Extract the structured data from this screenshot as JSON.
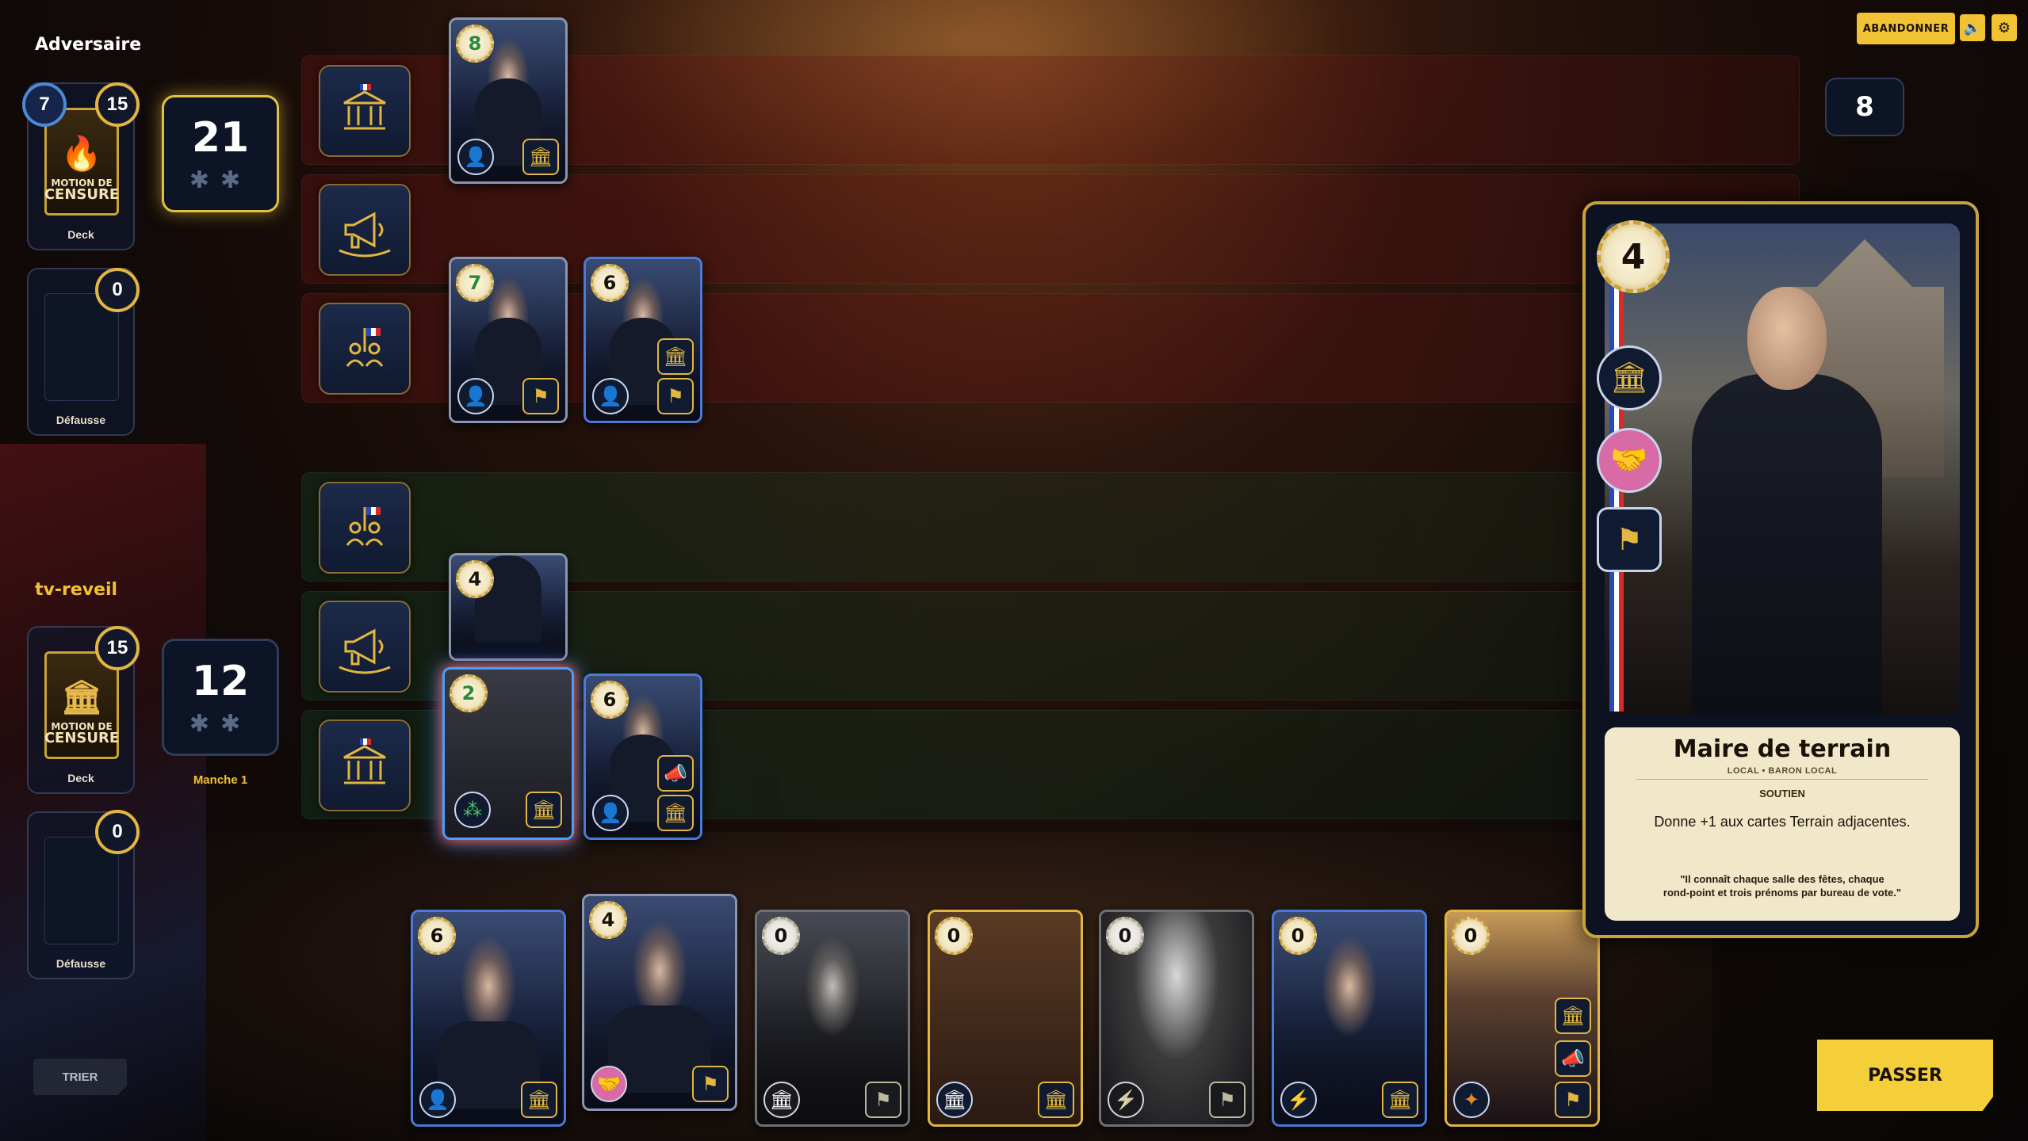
{
  "opponent": {
    "name": "Adversaire",
    "deck_label": "Deck",
    "deck_badge_left": "7",
    "deck_badge_right": "15",
    "discard_label": "Défausse",
    "discard_count": "0",
    "score": "21",
    "card_back_line1": "MOTION DE",
    "card_back_line2": "CENSURE"
  },
  "player": {
    "name": "tv-reveil",
    "deck_label": "Deck",
    "deck_badge": "15",
    "discard_label": "Défausse",
    "discard_count": "0",
    "score": "12",
    "round_label": "Manche 1",
    "card_back_line1": "MOTION DE",
    "card_back_line2": "CENSURE"
  },
  "controls": {
    "abandon_label": "ABANDONNER",
    "pass_label": "PASSER",
    "sort_label": "TRIER",
    "opponent_hand_count": "8"
  },
  "board": {
    "opponent_cards": [
      {
        "power": "8"
      },
      {
        "power": "7"
      },
      {
        "power": "6"
      }
    ],
    "player_cards": [
      {
        "power": "4"
      },
      {
        "power": "2"
      },
      {
        "power": "6"
      }
    ]
  },
  "hand": [
    {
      "power": "6"
    },
    {
      "power": "4"
    },
    {
      "power": "0"
    },
    {
      "power": "0"
    },
    {
      "power": "0"
    },
    {
      "power": "0"
    },
    {
      "power": "0"
    }
  ],
  "detail": {
    "power": "4",
    "name": "Maire de terrain",
    "tags": "LOCAL  •  BARON LOCAL",
    "type": "SOUTIEN",
    "effect": "Donne +1 aux cartes Terrain adjacentes.",
    "quote_line1": "\"Il connaît chaque salle des fêtes, chaque",
    "quote_line2": "rond-point et trois prénoms par bureau de vote.\""
  },
  "colors": {
    "accent": "#f2c235",
    "opponent_lane": "#6e1414",
    "player_lane": "#144628",
    "card_frame_blue": "#4a7ad8",
    "card_frame_gold": "#e2b640"
  },
  "icons": {
    "institution": "institution-icon",
    "megaphone": "megaphone-icon",
    "rally": "rally-icon",
    "person": "person-icon",
    "handshake": "handshake-icon",
    "lightning": "lightning-icon",
    "star": "star-icon"
  }
}
